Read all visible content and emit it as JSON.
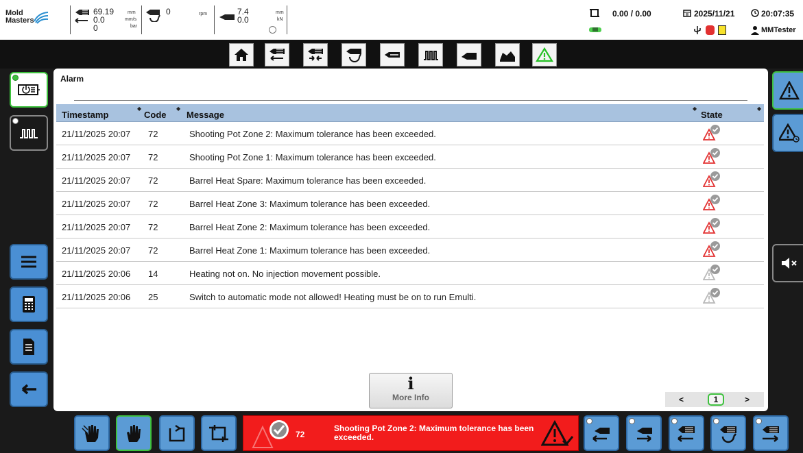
{
  "header": {
    "logo_line1": "Mold",
    "logo_line2": "Masters",
    "readouts": {
      "position": "69.19",
      "speed": "0.0",
      "pressure": "0",
      "rotation": "0",
      "rpm_value": "7.4",
      "rpm_sub": "0.0",
      "unit_mm": "mm",
      "unit_mms": "mm/s",
      "unit_bar": "bar",
      "unit_rpm": "rpm",
      "unit_mm2": "mm",
      "unit_kn": "kN"
    },
    "cycle": "0.00 / 0.00",
    "date": "2025/11/21",
    "time": "20:07:35",
    "user": "MMTester"
  },
  "nav": {
    "icons": [
      "home-icon",
      "injection-back-icon",
      "injection-hold-icon",
      "screw-rotation-icon",
      "nozzle-icon",
      "heating-icon",
      "ejector-icon",
      "profile-icon",
      "alarm-icon"
    ]
  },
  "panel": {
    "title": "Alarm",
    "columns": {
      "timestamp": "Timestamp",
      "code": "Code",
      "message": "Message",
      "state": "State"
    },
    "rows": [
      {
        "timestamp": "21/11/2025 20:07",
        "code": "72",
        "message": "Shooting Pot Zone 2: Maximum tolerance has been exceeded.",
        "state": "active-acknowledged"
      },
      {
        "timestamp": "21/11/2025 20:07",
        "code": "72",
        "message": "Shooting Pot Zone 1: Maximum tolerance has been exceeded.",
        "state": "active-acknowledged"
      },
      {
        "timestamp": "21/11/2025 20:07",
        "code": "72",
        "message": "Barrel Heat Spare: Maximum tolerance has been exceeded.",
        "state": "active-acknowledged"
      },
      {
        "timestamp": "21/11/2025 20:07",
        "code": "72",
        "message": "Barrel Heat Zone 3: Maximum tolerance has been exceeded.",
        "state": "active-acknowledged"
      },
      {
        "timestamp": "21/11/2025 20:07",
        "code": "72",
        "message": "Barrel Heat Zone 2: Maximum tolerance has been exceeded.",
        "state": "active-acknowledged"
      },
      {
        "timestamp": "21/11/2025 20:07",
        "code": "72",
        "message": "Barrel Heat Zone 1: Maximum tolerance has been exceeded.",
        "state": "active-acknowledged"
      },
      {
        "timestamp": "21/11/2025 20:06",
        "code": "14",
        "message": "Heating not on. No injection movement possible.",
        "state": "inactive-acknowledged"
      },
      {
        "timestamp": "21/11/2025 20:06",
        "code": "25",
        "message": "Switch to automatic mode not allowed! Heating must be on to run Emulti.",
        "state": "inactive-acknowledged"
      }
    ],
    "pager": {
      "prev": "<",
      "page": "1",
      "next": ">"
    },
    "more_info": "More Info",
    "more_info_glyph": "i"
  },
  "alarm_bar": {
    "code": "72",
    "message": "Shooting Pot Zone 2: Maximum tolerance has been exceeded."
  },
  "colors": {
    "accent_green": "#3ec13e",
    "button_blue": "#5b9bd5",
    "alarm_red": "#f21c1c",
    "grid_header": "#a8c2df"
  }
}
